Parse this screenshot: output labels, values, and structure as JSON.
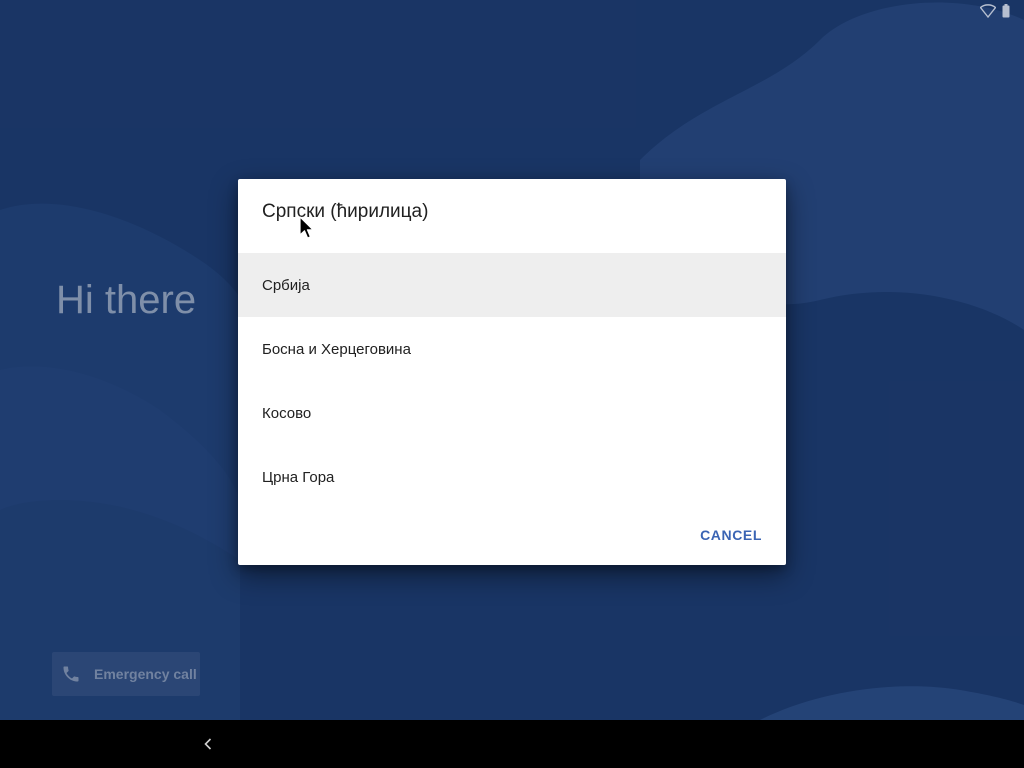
{
  "welcome": {
    "title": "Hi there"
  },
  "emergency": {
    "label": "Emergency call",
    "icon": "phone-icon"
  },
  "dialog": {
    "title": "Српски (ћирилица)",
    "items": [
      {
        "label": "Србија",
        "selected": true
      },
      {
        "label": "Босна и Херцеговина",
        "selected": false
      },
      {
        "label": "Косово",
        "selected": false
      },
      {
        "label": "Црна Гора",
        "selected": false
      }
    ],
    "cancel_label": "CANCEL"
  },
  "status_bar": {
    "icons": [
      "wifi-icon",
      "battery-icon"
    ]
  },
  "nav_bar": {
    "icons": [
      "back-icon"
    ]
  },
  "colors": {
    "background": "#1c3a6e",
    "accent": "#3a64b4",
    "dialog_bg": "#ffffff",
    "selected_row": "#eeeeee",
    "nav_bar": "#000000"
  }
}
